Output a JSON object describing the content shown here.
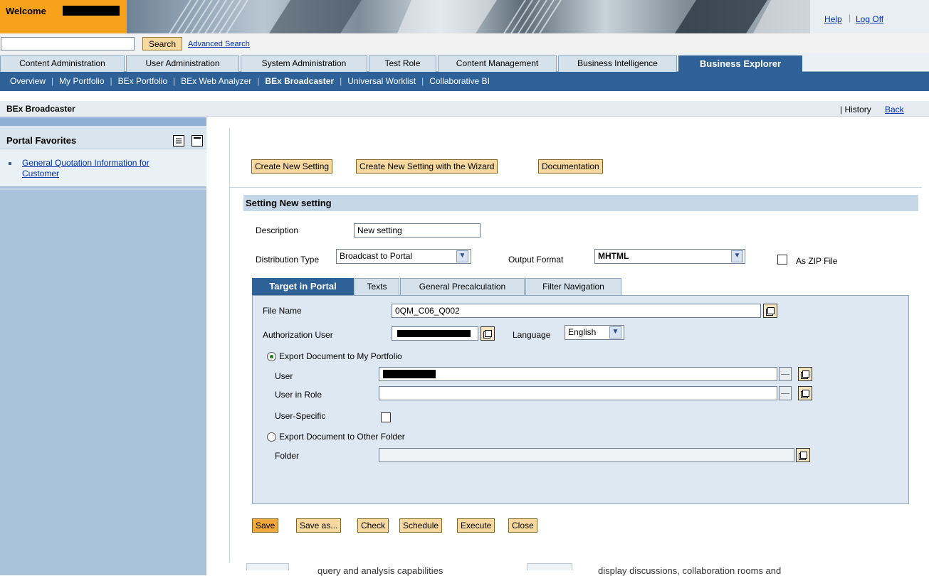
{
  "header": {
    "welcome_label": "Welcome",
    "help_link": "Help",
    "logoff_link": "Log Off"
  },
  "search": {
    "value": "",
    "button_label": "Search",
    "advanced_link": "Advanced Search"
  },
  "top_nav": {
    "tabs": [
      {
        "label": "Content Administration"
      },
      {
        "label": "User Administration"
      },
      {
        "label": "System Administration"
      },
      {
        "label": "Test Role"
      },
      {
        "label": "Content Management"
      },
      {
        "label": "Business Intelligence"
      },
      {
        "label": "Business Explorer",
        "active": true
      }
    ]
  },
  "sub_nav": {
    "items": [
      {
        "label": "Overview"
      },
      {
        "label": "My Portfolio"
      },
      {
        "label": "BEx Portfolio"
      },
      {
        "label": "BEx Web Analyzer"
      },
      {
        "label": "BEx Broadcaster",
        "active": true
      },
      {
        "label": "Universal Worklist"
      },
      {
        "label": "Collaborative BI"
      }
    ]
  },
  "page": {
    "title": "BEx Broadcaster",
    "history": "| History",
    "back": "Back"
  },
  "favorites": {
    "title": "Portal Favorites",
    "items": [
      {
        "label": "General Quotation Information for Customer"
      }
    ]
  },
  "toolbar_top": {
    "create_new": "Create New Setting",
    "create_wizard": "Create New Setting with the Wizard",
    "documentation": "Documentation"
  },
  "setting": {
    "title": "Setting New setting",
    "description_label": "Description",
    "description_value": "New setting",
    "distribution_label": "Distribution Type",
    "distribution_value": "Broadcast to Portal",
    "output_label": "Output Format",
    "output_value": "MHTML",
    "zip_label": "As ZIP File",
    "zip_checked": false
  },
  "tabs": {
    "items": [
      {
        "label": "Target in Portal",
        "active": true
      },
      {
        "label": "Texts"
      },
      {
        "label": "General Precalculation"
      },
      {
        "label": "Filter Navigation"
      }
    ]
  },
  "target": {
    "file_name_label": "File Name",
    "file_name_value": "0QM_C06_Q002",
    "auth_user_label": "Authorization User",
    "language_label": "Language",
    "language_value": "English",
    "export_my_portfolio": "Export Document to My Portfolio",
    "user_label": "User",
    "user_in_role_label": "User in Role",
    "user_specific_label": "User-Specific",
    "export_other_folder": "Export Document to Other Folder",
    "folder_label": "Folder"
  },
  "toolbar_bottom": {
    "save": "Save",
    "save_as": "Save as...",
    "check": "Check",
    "schedule": "Schedule",
    "execute": "Execute",
    "close": "Close"
  },
  "footer": {
    "text1": "query and analysis capabilities",
    "text2": "display discussions, collaboration rooms and"
  }
}
